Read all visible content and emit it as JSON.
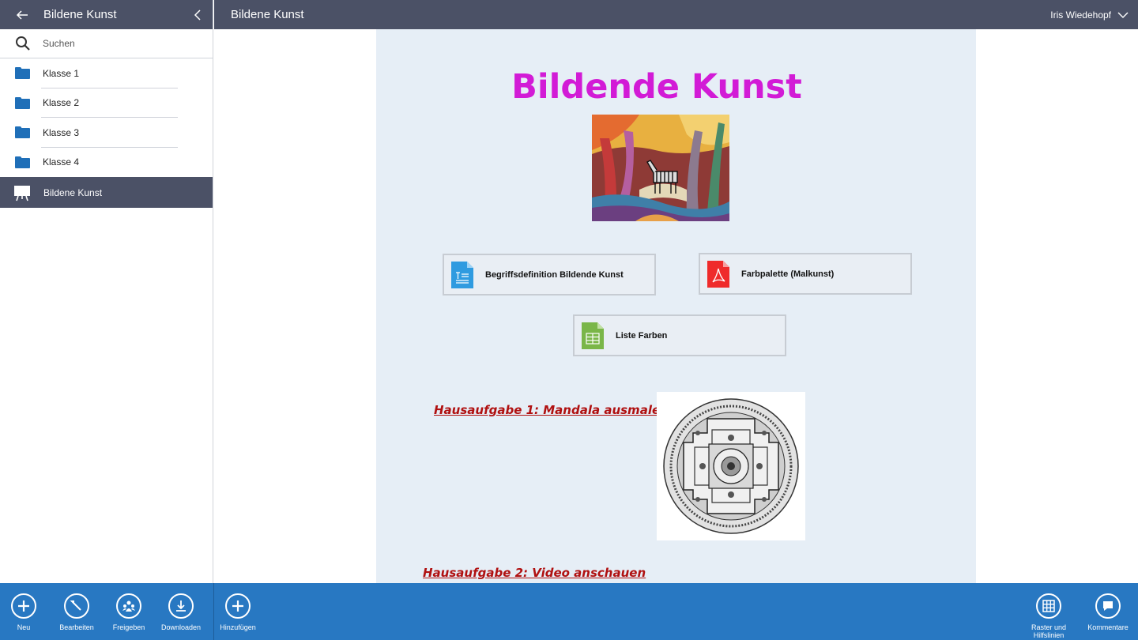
{
  "sidebar": {
    "title": "Bildene Kunst",
    "search_placeholder": "Suchen",
    "items": [
      {
        "label": "Klasse 1"
      },
      {
        "label": "Klasse 2"
      },
      {
        "label": "Klasse 3"
      },
      {
        "label": "Klasse 4"
      },
      {
        "label": "Bildene Kunst",
        "active": true
      }
    ]
  },
  "topbar": {
    "title": "Bildene Kunst",
    "user": "Iris Wiedehopf"
  },
  "page": {
    "title": "Bildende Kunst",
    "files": [
      {
        "label": "Begriffsdefinition Bildende Kunst",
        "type": "document-icon"
      },
      {
        "label": "Farbpalette (Malkunst)",
        "type": "pdf-icon"
      },
      {
        "label": "Liste Farben",
        "type": "spreadsheet-icon"
      }
    ],
    "homework": [
      {
        "label": "Hausaufgabe 1: Mandala ausmalen"
      },
      {
        "label": "Hausaufgabe 2: Video anschauen"
      }
    ]
  },
  "toolbar": {
    "left": [
      {
        "label": "Neu"
      },
      {
        "label": "Bearbeiten"
      },
      {
        "label": "Freigeben"
      },
      {
        "label": "Downloaden"
      }
    ],
    "add": {
      "label": "Hinzufügen"
    },
    "right": [
      {
        "label": "Raster und Hilfslinien"
      },
      {
        "label": "Kommentare"
      }
    ]
  },
  "colors": {
    "header_bg": "#4b5166",
    "toolbar_bg": "#2878c2",
    "folder": "#1f6fb8",
    "title": "#d21bd6",
    "link": "#b01010",
    "page_bg": "#e6eef6"
  }
}
